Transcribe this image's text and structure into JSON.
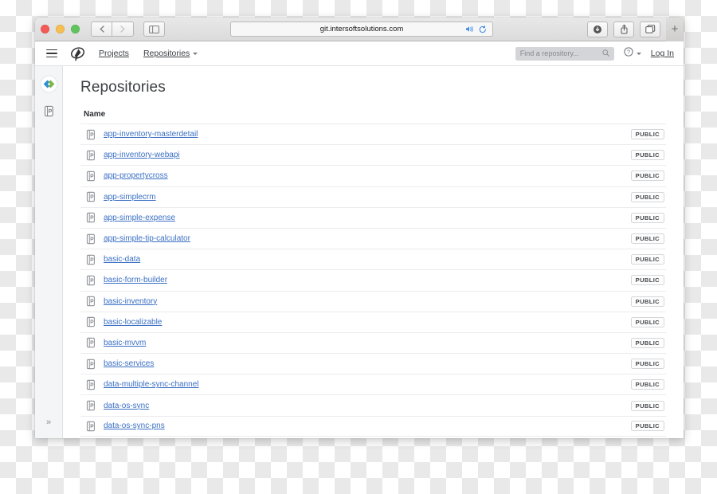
{
  "browser": {
    "traffic_lights": [
      "close",
      "minimize",
      "maximize"
    ],
    "back_label": "‹",
    "forward_label": "›",
    "sidebar_toggle_label": "sidebar",
    "url": "git.intersoftsolutions.com",
    "url_icons": [
      "audio-playing-icon",
      "reload-icon"
    ],
    "toolbar_right_icons": [
      "downloads-icon",
      "share-icon",
      "tabs-icon"
    ],
    "new_tab_label": "+"
  },
  "app_header": {
    "menu_label": "menu",
    "brand": "logo",
    "nav": [
      {
        "label": "Projects",
        "has_caret": false
      },
      {
        "label": "Repositories",
        "has_caret": true
      }
    ],
    "search_placeholder": "Find a repository...",
    "help_label": "?",
    "login_label": "Log In"
  },
  "left_rail": {
    "items": [
      {
        "name": "code-chevrons-icon"
      },
      {
        "name": "repository-icon"
      }
    ],
    "expand_label": "»"
  },
  "main": {
    "title": "Repositories",
    "columns": [
      "Name"
    ],
    "badge_label": "PUBLIC",
    "repositories": [
      {
        "name": "app-inventory-masterdetail",
        "visibility": "PUBLIC"
      },
      {
        "name": "app-inventory-webapi",
        "visibility": "PUBLIC"
      },
      {
        "name": "app-propertycross",
        "visibility": "PUBLIC"
      },
      {
        "name": "app-simplecrm",
        "visibility": "PUBLIC"
      },
      {
        "name": "app-simple-expense",
        "visibility": "PUBLIC"
      },
      {
        "name": "app-simple-tip-calculator",
        "visibility": "PUBLIC"
      },
      {
        "name": "basic-data",
        "visibility": "PUBLIC"
      },
      {
        "name": "basic-form-builder",
        "visibility": "PUBLIC"
      },
      {
        "name": "basic-inventory",
        "visibility": "PUBLIC"
      },
      {
        "name": "basic-localizable",
        "visibility": "PUBLIC"
      },
      {
        "name": "basic-mvvm",
        "visibility": "PUBLIC"
      },
      {
        "name": "basic-services",
        "visibility": "PUBLIC"
      },
      {
        "name": "data-multiple-sync-channel",
        "visibility": "PUBLIC"
      },
      {
        "name": "data-os-sync",
        "visibility": "PUBLIC"
      },
      {
        "name": "data-os-sync-pns",
        "visibility": "PUBLIC"
      }
    ]
  },
  "colors": {
    "link": "#3a6fc4",
    "header_text": "#3c4043",
    "rail_bg": "#f4f5f7",
    "accent_blue": "#3b8ae5"
  }
}
